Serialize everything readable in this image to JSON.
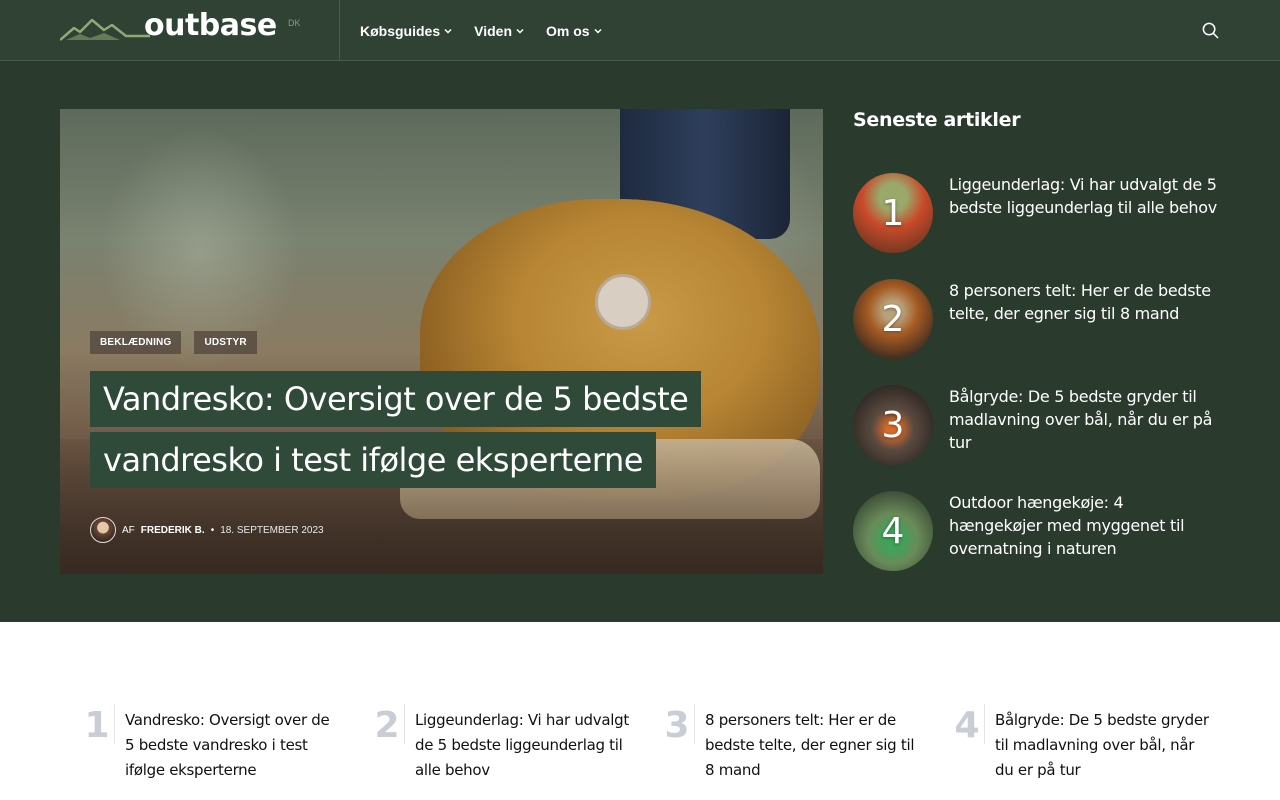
{
  "header": {
    "logo_text": "outbase",
    "logo_tld": "DK",
    "nav": [
      {
        "label": "Købsguides"
      },
      {
        "label": "Viden"
      },
      {
        "label": "Om os"
      }
    ],
    "search_icon": "search-icon"
  },
  "feature": {
    "categories": [
      "BEKLÆDNING",
      "UDSTYR"
    ],
    "title_line1": "Vandresko: Oversigt over de 5 bedste",
    "title_line2": "vandresko i test ifølge eksperterne",
    "author_prefix": "AF",
    "author": "FREDERIK B.",
    "date": "18. SEPTEMBER 2023"
  },
  "sidebar": {
    "heading": "Seneste artikler",
    "items": [
      {
        "num": "1",
        "title": "Liggeunderlag: Vi har udvalgt de 5 bedste liggeunderlag til alle behov"
      },
      {
        "num": "2",
        "title": "8 personers telt: Her er de bedste telte, der egner sig til 8 mand"
      },
      {
        "num": "3",
        "title": "Bålgryde: De 5 bedste gryder til madlavning over bål, når du er på tur"
      },
      {
        "num": "4",
        "title": "Outdoor hængekøje: 4 hængekøjer med myggenet til overnatning i naturen"
      }
    ]
  },
  "bottom": {
    "items": [
      {
        "num": "1",
        "title": "Vandresko: Oversigt over de 5 bedste vandresko i test ifølge eksperterne"
      },
      {
        "num": "2",
        "title": "Liggeunderlag: Vi har udvalgt de 5 bedste liggeunderlag til alle behov"
      },
      {
        "num": "3",
        "title": "8 personers telt: Her er de bedste telte, der egner sig til 8 mand"
      },
      {
        "num": "4",
        "title": "Bålgryde: De 5 bedste gryder til madlavning over bål, når du er på tur"
      }
    ]
  },
  "colors": {
    "header_bg": "#2f4234",
    "hero_bg": "#2a3a2d",
    "title_bg": "#2f4a38",
    "number_gray": "#c9ced6"
  }
}
